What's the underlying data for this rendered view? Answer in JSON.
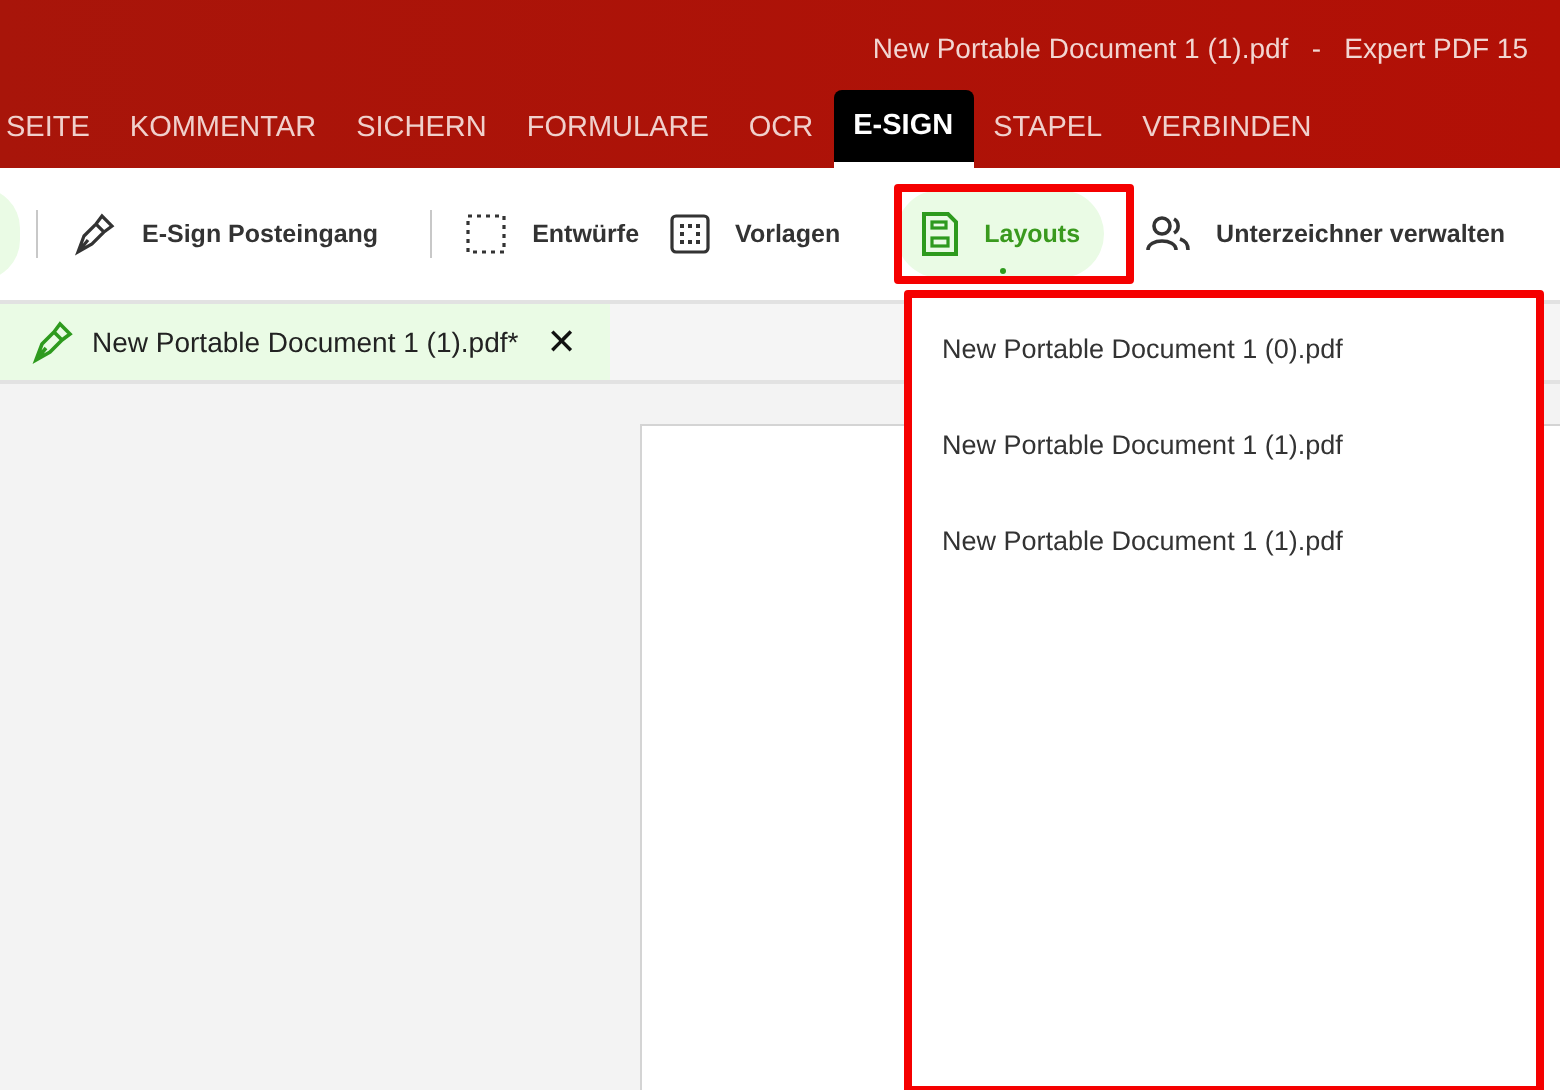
{
  "window": {
    "title": "New Portable Document 1 (1).pdf   -   Expert PDF 15"
  },
  "tabs": [
    {
      "label": "SEITE",
      "selected": false
    },
    {
      "label": "KOMMENTAR",
      "selected": false
    },
    {
      "label": "SICHERN",
      "selected": false
    },
    {
      "label": "FORMULARE",
      "selected": false
    },
    {
      "label": "OCR",
      "selected": false
    },
    {
      "label": "E-SIGN",
      "selected": true
    },
    {
      "label": "STAPEL",
      "selected": false
    },
    {
      "label": "VERBINDEN",
      "selected": false
    }
  ],
  "toolbar": [
    {
      "kind": "pen",
      "label": "E-Sign Posteingang",
      "selected": false
    },
    {
      "kind": "dashed",
      "label": "Entwürfe",
      "selected": false
    },
    {
      "kind": "dotted",
      "label": "Vorlagen",
      "selected": false
    },
    {
      "kind": "save",
      "label": "Layouts",
      "selected": true
    },
    {
      "kind": "people",
      "label": "Unterzeichner verwalten",
      "selected": false
    }
  ],
  "document_tab": {
    "title": "New Portable Document 1 (1).pdf*",
    "close": "✕"
  },
  "dropdown": {
    "items": [
      "New Portable Document 1 (0).pdf",
      "New Portable Document 1 (1).pdf",
      "New Portable Document 1 (1).pdf"
    ]
  }
}
